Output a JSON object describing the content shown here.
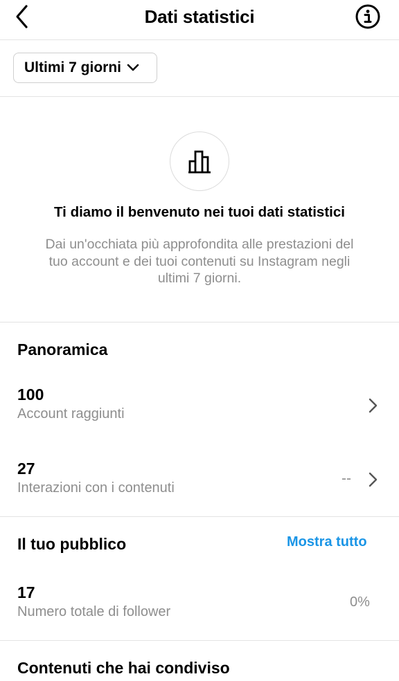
{
  "header": {
    "title": "Dati statistici"
  },
  "range": {
    "selected": "Ultimi 7 giorni"
  },
  "welcome": {
    "title": "Ti diamo il benvenuto nei tuoi dati statistici",
    "description": "Dai un'occhiata più approfondita alle prestazioni del tuo account e dei tuoi contenuti su Instagram negli ultimi 7 giorni."
  },
  "overview": {
    "title": "Panoramica",
    "items": [
      {
        "value": "100",
        "label": "Account raggiunti"
      },
      {
        "value": "27",
        "label": "Interazioni con i contenuti",
        "change": "--"
      }
    ]
  },
  "audience": {
    "title": "Il tuo pubblico",
    "show_all": "Mostra tutto",
    "items": [
      {
        "value": "17",
        "label": "Numero totale di follower",
        "change": "0%"
      }
    ]
  },
  "shared": {
    "title": "Contenuti che hai condiviso"
  }
}
